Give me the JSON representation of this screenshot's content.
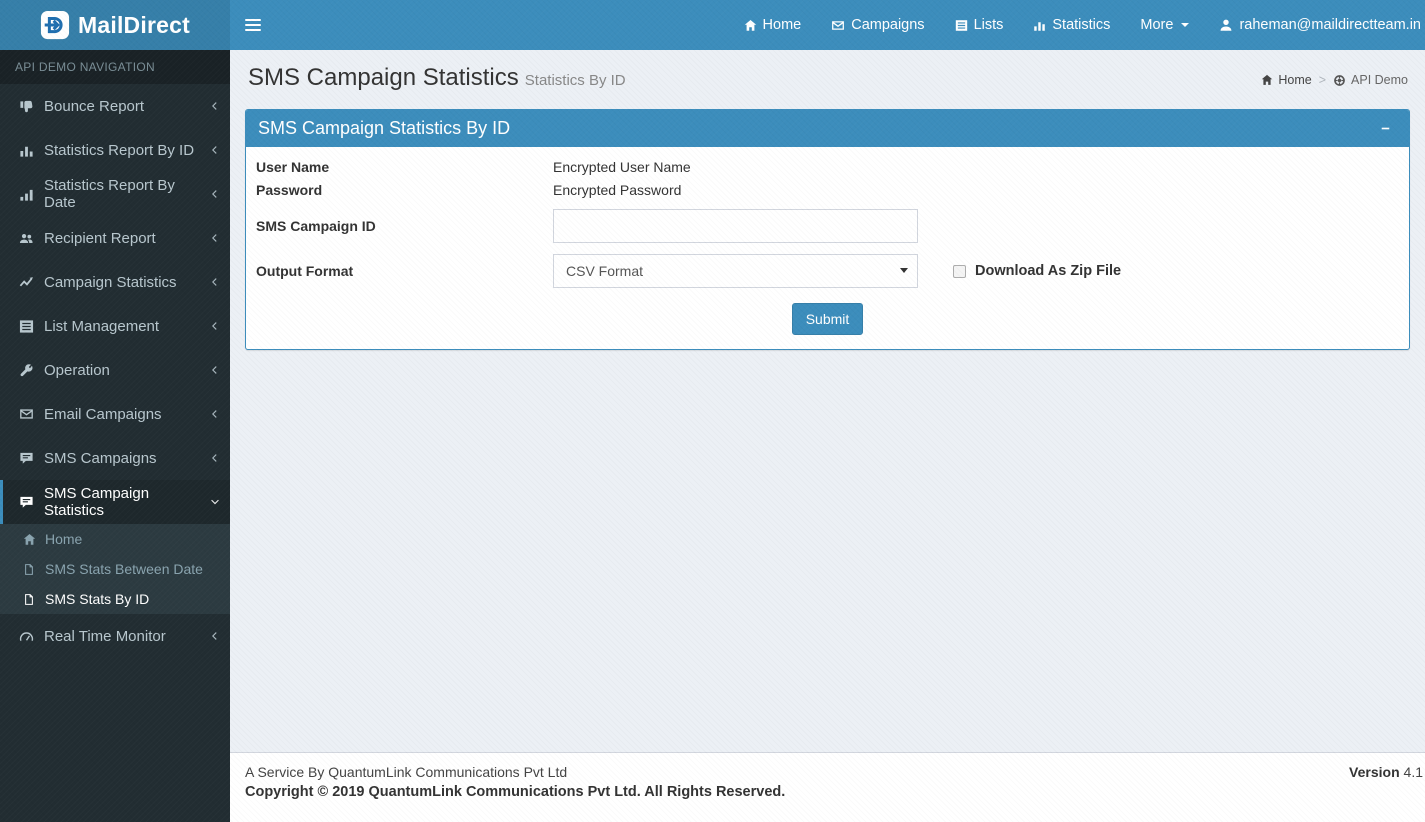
{
  "colors": {
    "primary": "#3c8dbc",
    "logo_bg": "#367fa9",
    "sidebar_bg": "#222d32",
    "sidebar_active_bg": "#1e282c",
    "submenu_bg": "#2c3b41",
    "content_bg": "#ecf0f5"
  },
  "navbar": {
    "brand": "MailDirect",
    "items": [
      {
        "label": "Home",
        "icon": "home-icon"
      },
      {
        "label": "Campaigns",
        "icon": "envelope-icon"
      },
      {
        "label": "Lists",
        "icon": "list-icon"
      },
      {
        "label": "Statistics",
        "icon": "bar-chart-icon"
      },
      {
        "label": "More",
        "icon": "caret-down-icon"
      },
      {
        "label": "raheman@maildirectteam.in",
        "icon": "user-icon"
      }
    ]
  },
  "sidebar": {
    "section_header": "API DEMO NAVIGATION",
    "items": [
      {
        "label": "Bounce Report",
        "icon": "thumbs-down-icon"
      },
      {
        "label": "Statistics Report By ID",
        "icon": "bar-chart-icon"
      },
      {
        "label": "Statistics Report By Date",
        "icon": "ascending-bars-icon"
      },
      {
        "label": "Recipient Report",
        "icon": "users-icon"
      },
      {
        "label": "Campaign Statistics",
        "icon": "line-chart-icon"
      },
      {
        "label": "List Management",
        "icon": "list-icon"
      },
      {
        "label": "Operation",
        "icon": "wrench-icon"
      },
      {
        "label": "Email Campaigns",
        "icon": "envelope-icon"
      },
      {
        "label": "SMS Campaigns",
        "icon": "comment-icon"
      },
      {
        "label": "SMS Campaign Statistics",
        "icon": "comment-icon",
        "active": true,
        "expanded": true
      },
      {
        "label": "Real Time Monitor",
        "icon": "gauge-icon"
      }
    ],
    "submenu": [
      {
        "label": "Home",
        "icon": "home-icon"
      },
      {
        "label": "SMS Stats Between Date",
        "icon": "file-icon"
      },
      {
        "label": "SMS Stats By ID",
        "icon": "file-icon",
        "active": true
      }
    ]
  },
  "page_header": {
    "title": "SMS Campaign Statistics",
    "subtitle": "Statistics By ID"
  },
  "breadcrumb": {
    "home": "Home",
    "current": "API Demo"
  },
  "panel": {
    "title": "SMS Campaign Statistics By ID",
    "form": {
      "user_name_label": "User Name",
      "user_name_value": "Encrypted User Name",
      "password_label": "Password",
      "password_value": "Encrypted Password",
      "campaign_id_label": "SMS Campaign ID",
      "campaign_id_value": "",
      "output_format_label": "Output Format",
      "output_format_value": "CSV Format",
      "zip_label": "Download As Zip File",
      "zip_checked": false,
      "submit_label": "Submit"
    }
  },
  "footer": {
    "service_line": "A Service By QuantumLink Communications Pvt Ltd",
    "copyright": "Copyright © 2019 QuantumLink Communications Pvt Ltd. All Rights Reserved.",
    "version_label": "Version",
    "version_value": "4.1"
  }
}
